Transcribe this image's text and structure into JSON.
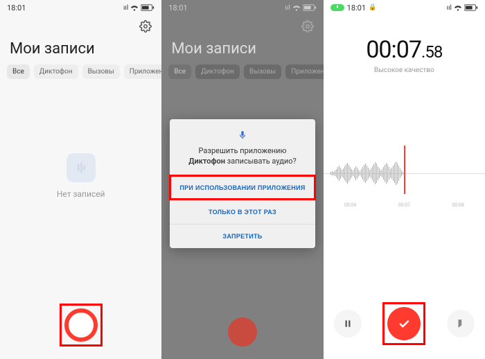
{
  "status": {
    "time": "18:01",
    "time_pill": "18:01",
    "signal": "••ıl",
    "wifi": "wifi",
    "battery": "62"
  },
  "screen1": {
    "title": "Мои записи",
    "tabs": [
      "Все",
      "Диктофон",
      "Вызовы",
      "Приложения"
    ],
    "empty": "Нет записей"
  },
  "screen2": {
    "title": "Мои записи",
    "tabs": [
      "Все",
      "Диктофон",
      "Вызовы",
      "Приложения"
    ],
    "dialog": {
      "line1": "Разрешить приложению",
      "app": "Диктофон",
      "line2": " записывать аудио?",
      "btn1": "ПРИ ИСПОЛЬЗОВАНИИ ПРИЛОЖЕНИЯ",
      "btn2": "ТОЛЬКО В ЭТОТ РАЗ",
      "btn3": "ЗАПРЕТИТЬ"
    }
  },
  "screen3": {
    "timer_main": "00:07",
    "timer_cs": ".58",
    "quality": "Высокое качество",
    "ticks": [
      "00:04",
      "00:07",
      "00:08"
    ]
  },
  "colors": {
    "red": "#ff3b30",
    "highlight": "#ff0000",
    "blue": "#1565c0",
    "green": "#4cd964"
  }
}
